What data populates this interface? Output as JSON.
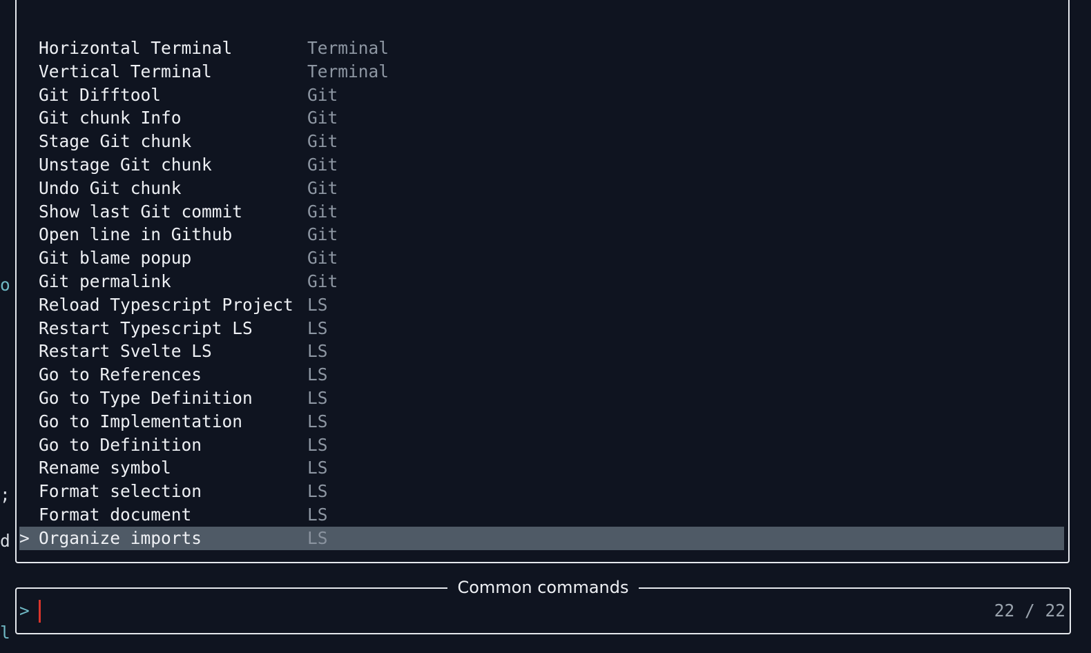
{
  "commands": [
    {
      "name": "Horizontal Terminal",
      "category": "Terminal"
    },
    {
      "name": "Vertical Terminal",
      "category": "Terminal"
    },
    {
      "name": "Git Difftool",
      "category": "Git"
    },
    {
      "name": "Git chunk Info",
      "category": "Git"
    },
    {
      "name": "Stage Git chunk",
      "category": "Git"
    },
    {
      "name": "Unstage Git chunk",
      "category": "Git"
    },
    {
      "name": "Undo Git chunk",
      "category": "Git"
    },
    {
      "name": "Show last Git commit",
      "category": "Git"
    },
    {
      "name": "Open line in Github",
      "category": "Git"
    },
    {
      "name": "Git blame popup",
      "category": "Git"
    },
    {
      "name": "Git permalink",
      "category": "Git"
    },
    {
      "name": "Reload Typescript Project",
      "category": "LS"
    },
    {
      "name": "Restart Typescript LS",
      "category": "LS"
    },
    {
      "name": "Restart Svelte LS",
      "category": "LS"
    },
    {
      "name": "Go to References",
      "category": "LS"
    },
    {
      "name": "Go to Type Definition",
      "category": "LS"
    },
    {
      "name": "Go to Implementation",
      "category": "LS"
    },
    {
      "name": "Go to Definition",
      "category": "LS"
    },
    {
      "name": "Rename symbol",
      "category": "LS"
    },
    {
      "name": "Format selection",
      "category": "LS"
    },
    {
      "name": "Format document",
      "category": "LS"
    },
    {
      "name": "Organize imports",
      "category": "LS"
    }
  ],
  "selected_caret": ">",
  "gutter": {
    "g1": "o",
    "g2": ";",
    "g3": "d",
    "g4": "l"
  },
  "prompt": {
    "title": "Common commands",
    "caret": ">",
    "value": "",
    "count": "22 / 22"
  },
  "colors": {
    "background": "#0f1420",
    "selection": "#4f5a66",
    "border": "#e6e9ee",
    "category_text": "#8e97a3",
    "accent_caret": "#6fb8c4",
    "cursor": "#d9342b"
  }
}
